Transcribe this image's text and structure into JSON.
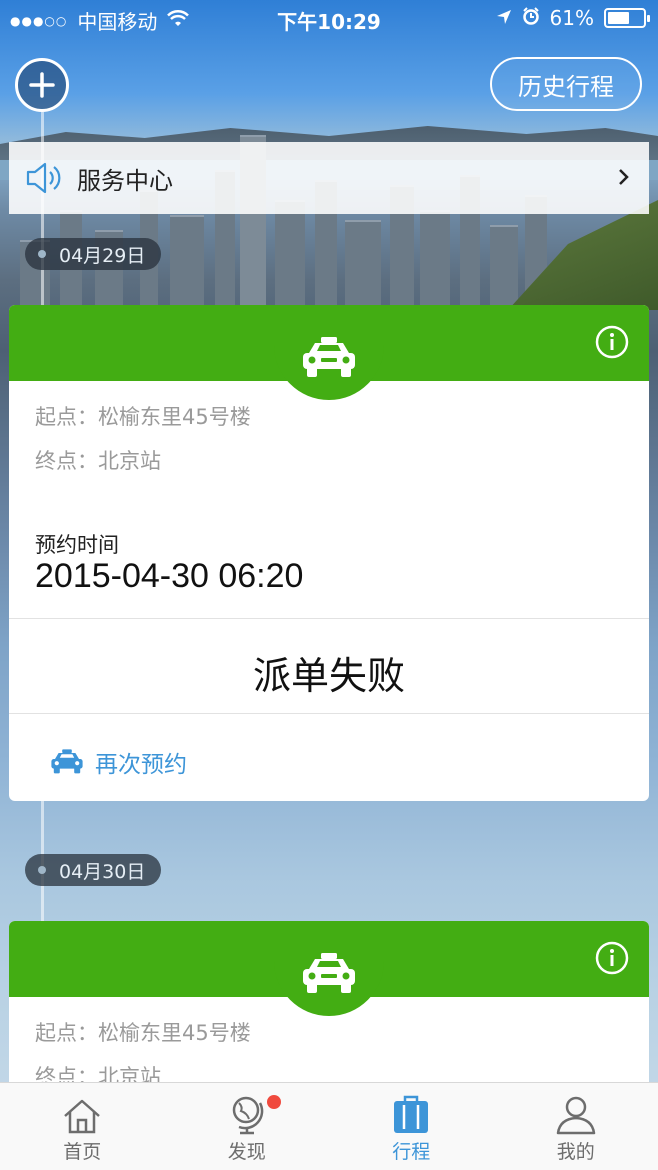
{
  "status_bar": {
    "carrier": "中国移动",
    "time": "下午10:29",
    "battery": "61%",
    "battery_level": 0.61
  },
  "header": {
    "history_button": "历史行程"
  },
  "service_center": {
    "label": "服务中心"
  },
  "trips": [
    {
      "date": "04月29日",
      "start_label": "起点：",
      "start": "松榆东里45号楼",
      "end_label": "终点：",
      "end": "北京站",
      "reserve_label": "预约时间",
      "reserve_time": "2015-04-30 06:20",
      "status": "派单失败",
      "rebook": "再次预约"
    },
    {
      "date": "04月30日",
      "start_label": "起点：",
      "start": "松榆东里45号楼",
      "end_label": "终点：",
      "end": "北京站"
    }
  ],
  "tabbar": {
    "items": [
      {
        "label": "首页",
        "icon": "home-icon"
      },
      {
        "label": "发现",
        "icon": "globe-icon",
        "badge": true
      },
      {
        "label": "行程",
        "icon": "suitcase-icon",
        "active": true
      },
      {
        "label": "我的",
        "icon": "user-icon"
      }
    ]
  },
  "colors": {
    "green": "#43ad13",
    "blue": "#3d95d8",
    "badge": "#f04a3e"
  }
}
